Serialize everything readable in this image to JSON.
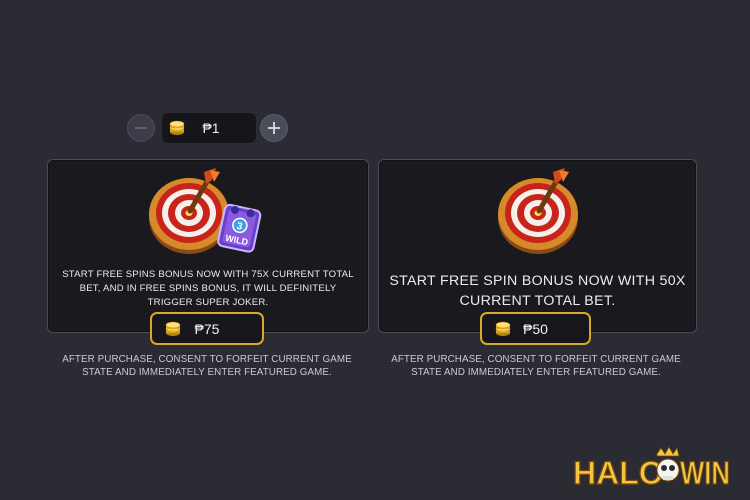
{
  "bet": {
    "value": "₱1",
    "coin_icon": "coin-stack-icon",
    "minus_icon": "minus-icon",
    "plus_icon": "plus-icon"
  },
  "offers": [
    {
      "description": "START FREE SPINS BONUS NOW WITH 75X CURRENT TOTAL BET, AND IN FREE SPINS BONUS, IT WILL DEFINITELY TRIGGER SUPER JOKER.",
      "price": "₱75",
      "note": "AFTER PURCHASE, CONSENT TO FORFEIT CURRENT GAME STATE AND IMMEDIATELY ENTER FEATURED GAME.",
      "art": "dart-target-with-wild-icon",
      "badge_text": "WILD",
      "badge_number": "3"
    },
    {
      "description": "START FREE SPIN BONUS NOW WITH 50X CURRENT TOTAL BET.",
      "price": "₱50",
      "note": "AFTER PURCHASE, CONSENT TO FORFEIT CURRENT GAME STATE AND IMMEDIATELY ENTER FEATURED GAME.",
      "art": "dart-target-icon"
    }
  ],
  "logo": {
    "text_left": "HALO",
    "text_right": "WIN"
  },
  "colors": {
    "background": "#2b2b33",
    "card": "#19191e",
    "gold": "#d6a72a",
    "target_red": "#c8241c"
  }
}
